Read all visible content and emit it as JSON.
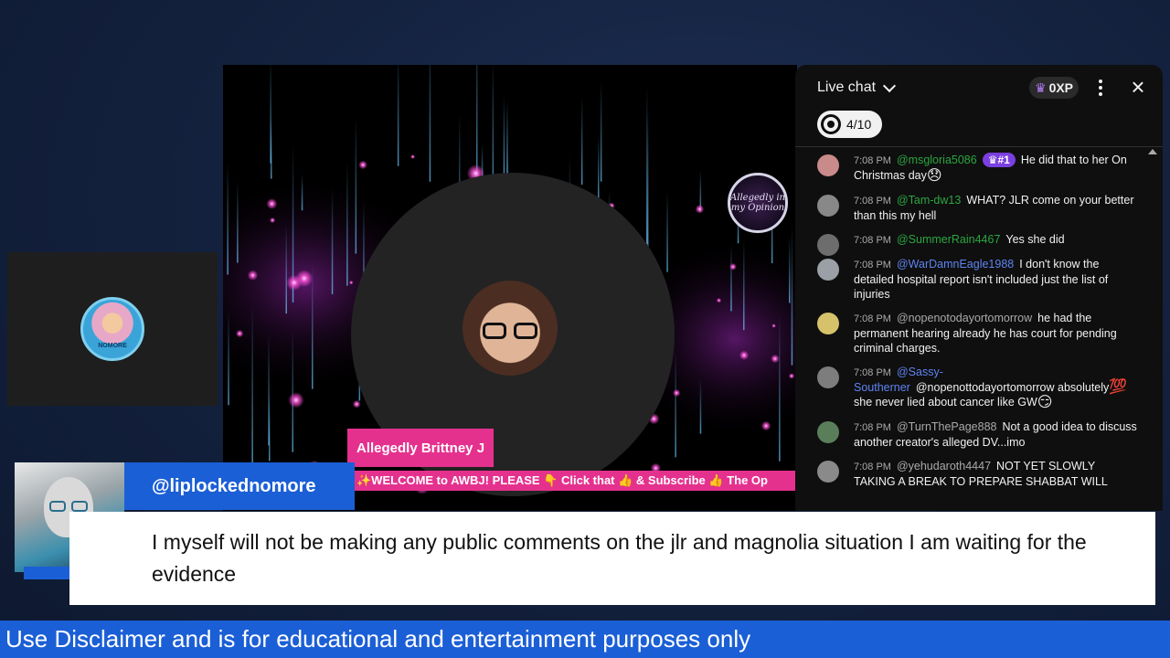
{
  "stage": {
    "host_name": "Allegedly Brittney J",
    "ticker": "✨WELCOME to AWBJ! PLEASE 👇 Click that 👍 & Subscribe 👍 The Op",
    "logo_text": "Allegedly in my Opinion",
    "side_logo_text": "NOMORE"
  },
  "chat": {
    "title": "Live chat",
    "xp": "0XP",
    "goal": "4/10",
    "messages": [
      {
        "time": "7:08 PM",
        "author": "@msgloria5086",
        "author_color": "#2ba640",
        "rank": "#1",
        "text": "He did that to her On Christmas day",
        "emoji": "😞",
        "avatar_color": "#c98a8a"
      },
      {
        "time": "7:08 PM",
        "author": "@Tam-dw13",
        "author_color": "#2ba640",
        "text": "WHAT? JLR come on your better than this my hell",
        "avatar_color": "#888888"
      },
      {
        "time": "7:08 PM",
        "author": "@SummerRain4467",
        "author_color": "#2ba640",
        "text": "Yes she did",
        "avatar_color": "#6d6d6d"
      },
      {
        "time": "7:08 PM",
        "author": "@WarDamnEagle1988",
        "author_color": "#5e84f1",
        "text": "I don't know the detailed hospital report isn't included just the list of injuries",
        "avatar_color": "#9aa0a6"
      },
      {
        "time": "7:08 PM",
        "author": "@nopenotodayortomorrow",
        "author_color": "#aaaaaa",
        "text": "he had the permanent hearing already he has court for pending criminal charges.",
        "avatar_color": "#d6c26a"
      },
      {
        "time": "7:08 PM",
        "author": "@Sassy-Southerner",
        "author_color": "#5e84f1",
        "text": "@nopenottodayortomorrow absolutely",
        "text2": "she never lied about cancer like GW",
        "emoji": "💯",
        "emoji2": "😏",
        "avatar_color": "#7d7d7d"
      },
      {
        "time": "7:08 PM",
        "author": "@TurnThePage888",
        "author_color": "#aaaaaa",
        "text": "Not a good idea to discuss another creator's alleged DV...imo",
        "avatar_color": "#5a7d5a"
      },
      {
        "time": "7:08 PM",
        "author": "@yehudaroth4447",
        "author_color": "#aaaaaa",
        "text": "NOT YET SLOWLY TAKING A BREAK TO PREPARE SHABBAT WILL",
        "avatar_color": "#8a8a8a"
      }
    ]
  },
  "comment": {
    "username": "@liplockednomore",
    "text": "I myself will not be making any public comments on the jlr and magnolia situation I am waiting for the evidence"
  },
  "footer": {
    "disclaimer": "Use Disclaimer and is for educational and entertainment purposes only"
  }
}
